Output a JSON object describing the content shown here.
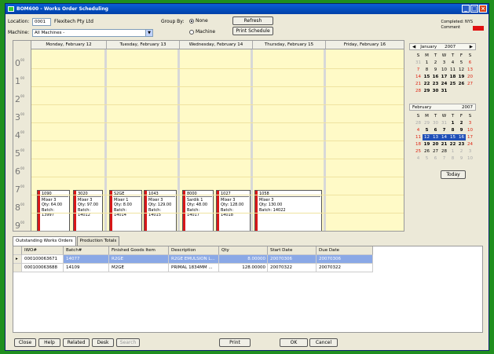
{
  "window": {
    "title": "BOM600 - Works Order Scheduling"
  },
  "toolbar": {
    "location_label": "Location:",
    "location_code": "0001",
    "location_name": "Flexitech Pty Ltd",
    "machine_label": "Machine:",
    "machine_value": "All Machines -",
    "groupby_label": "Group By:",
    "groupby_none": "None",
    "groupby_machine": "Machine",
    "refresh_label": "Refresh",
    "print_schedule_label": "Print Schedule",
    "completed_label": "Completed: NYS",
    "comment_label": "Comment"
  },
  "schedule": {
    "days": [
      "Monday, February 12",
      "Tuesday, February 13",
      "Wednesday, February 14",
      "Thursday, February 15",
      "Friday, February 16"
    ],
    "hours": [
      {
        "h": "0",
        "m": "00"
      },
      {
        "h": "1",
        "m": "00"
      },
      {
        "h": "2",
        "m": "00"
      },
      {
        "h": "3",
        "m": "00"
      },
      {
        "h": "4",
        "m": "00"
      },
      {
        "h": "5",
        "m": "00"
      },
      {
        "h": "6",
        "m": "00"
      },
      {
        "h": "7",
        "m": "00"
      },
      {
        "h": "8",
        "m": "00"
      },
      {
        "h": "9",
        "m": "00"
      }
    ],
    "jobs": [
      {
        "id": "1090",
        "machine": "Mixer 3",
        "qty": "Qty: 64.00",
        "batch_label": "Batch:",
        "batch": "13997"
      },
      {
        "id": "3020",
        "machine": "Mixer 3",
        "qty": "Qty: 97.00",
        "batch_label": "Batch:",
        "batch": "14012"
      },
      {
        "id": "S2GE",
        "machine": "Mixer 1",
        "qty": "Qty: 8.00",
        "batch_label": "Batch:",
        "batch": "14014"
      },
      {
        "id": "1043",
        "machine": "Mixer 3",
        "qty": "Qty: 129.00",
        "batch_label": "Batch:",
        "batch": "14015"
      },
      {
        "id": "8000",
        "machine": "Sardik 1",
        "qty": "Qty: 48.00",
        "batch_label": "Batch:",
        "batch": "14017"
      },
      {
        "id": "1027",
        "machine": "Mixer 3",
        "qty": "Qty: 128.00",
        "batch_label": "Batch:",
        "batch": "14018"
      },
      {
        "id": "1058",
        "machine": "Mixer 3",
        "qty": "Qty: 130.00",
        "batch_label": "Batch: 14022",
        "batch": ""
      }
    ]
  },
  "calendars": [
    {
      "month": "January",
      "year": "2007",
      "dow": [
        "S",
        "M",
        "T",
        "W",
        "T",
        "F",
        "S"
      ],
      "weeks": [
        [
          "31",
          "1",
          "2",
          "3",
          "4",
          "5",
          "6"
        ],
        [
          "7",
          "8",
          "9",
          "10",
          "11",
          "12",
          "13"
        ],
        [
          "14",
          "15",
          "16",
          "17",
          "18",
          "19",
          "20"
        ],
        [
          "21",
          "22",
          "23",
          "24",
          "25",
          "26",
          "27"
        ],
        [
          "28",
          "29",
          "30",
          "31",
          "",
          "",
          ""
        ]
      ]
    },
    {
      "month": "February",
      "year": "2007",
      "dow": [
        "S",
        "M",
        "T",
        "W",
        "T",
        "F",
        "S"
      ],
      "weeks": [
        [
          "28",
          "29",
          "30",
          "31",
          "1",
          "2",
          "3"
        ],
        [
          "4",
          "5",
          "6",
          "7",
          "8",
          "9",
          "10"
        ],
        [
          "11",
          "12",
          "13",
          "14",
          "15",
          "16",
          "17"
        ],
        [
          "18",
          "19",
          "20",
          "21",
          "22",
          "23",
          "24"
        ],
        [
          "25",
          "26",
          "27",
          "28",
          "1",
          "2",
          "3"
        ],
        [
          "4",
          "5",
          "6",
          "7",
          "8",
          "9",
          "10"
        ]
      ],
      "today_label": "Today"
    }
  ],
  "tabs": [
    "Outstanding Works Orders",
    "Production Totals"
  ],
  "grid": {
    "columns": [
      "IWO#",
      "Batch#",
      "Finished Goods Item",
      "Description",
      "Qty",
      "Start Date",
      "Due Date"
    ],
    "rows": [
      [
        "000100063671",
        "14077",
        "R2GE",
        "R2GE EMULSION L...",
        "8.00000",
        "20070306",
        "20070306"
      ],
      [
        "000100063688",
        "14109",
        "M2GE",
        "PRIMAL 1834MM ...",
        "128.00000",
        "20070322",
        "20070322"
      ]
    ]
  },
  "buttons": {
    "close": "Close",
    "help": "Help",
    "related": "Related",
    "desk": "Desk",
    "search": "Search",
    "print": "Print",
    "ok": "OK",
    "cancel": "Cancel"
  }
}
